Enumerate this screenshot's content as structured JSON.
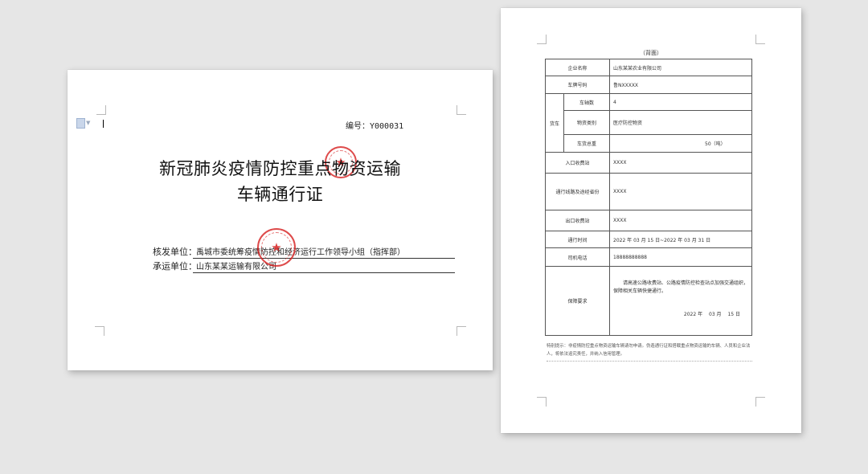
{
  "front_page": {
    "serial": "编号：Y000031",
    "title_line1": "新冠肺炎疫情防控重点物资运输",
    "title_line2": "车辆通行证",
    "issuer_label": "核发单位：",
    "issuer_value": "禹城市委统筹疫情防控和经济运行工作领导小组（指挥部）",
    "carrier_label": "承运单位：",
    "carrier_value": "山东某某运输有限公司"
  },
  "back_page": {
    "title": "（背面）",
    "rows": {
      "company_label": "企业名称",
      "company_value": "山东某某农业有限公司",
      "plate_label": "车牌号码",
      "plate_value": "鲁NXXXXX",
      "truck_label": "货车",
      "axles_label": "车轴数",
      "axles_value": "4",
      "goods_label": "物资类别",
      "goods_value": "医疗防控物资",
      "weight_label": "车货总重",
      "weight_value": "50（吨）",
      "entry_label": "入口收费站",
      "entry_value": "XXXX",
      "route_label": "通行线路及途经省份",
      "route_value": "XXXX",
      "exit_label": "出口收费站",
      "exit_value": "XXXX",
      "time_label": "通行时间",
      "time_value": "2022 年 03 月 15 日~2022 年 03 月 31 日",
      "phone_label": "司机电话",
      "phone_value": "18888888888",
      "guarantee_label": "保障要求",
      "guarantee_text": "请高速公路收费站、公路疫情防控检查站点加强交通组织，保障相关车辆快捷通行。",
      "guarantee_date": "2022 年　 03 月　 15 日"
    },
    "note": "特别提示：非疫情防控重点物资运输车辆请勿申请。伪造通行证和搭载重点物资运输的车辆、人员和企业法人，将依法追究责任，并纳入信用管理。"
  }
}
